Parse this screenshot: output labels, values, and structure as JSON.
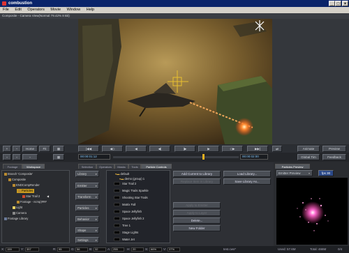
{
  "window": {
    "title": "combustion",
    "minimize": "_",
    "maximize": "□",
    "close": "×"
  },
  "menu": [
    "File",
    "Edit",
    "Operators",
    "Movie",
    "Window",
    "Help"
  ],
  "viewport": {
    "title": "Composite - Camera View(Normal 79.42% 8 Bit)"
  },
  "toolbar": {
    "home": "Home",
    "fit": "Fit",
    "animate": "Animate",
    "preview": "Preview",
    "feedback": "Feedback",
    "global_time": "Global Tim"
  },
  "timebar": {
    "current": "00:00:01:12",
    "end": "00:00:02:00"
  },
  "tabs_left": [
    "Footage",
    "Workspace"
  ],
  "tabs_mid": [
    "Selection",
    "Operators",
    "Masks",
    "Tools",
    "Particle Controls"
  ],
  "preview_tab": "Particles Preview",
  "preview_mode": "Emitter Preview",
  "preview_fps": "fps 30",
  "tree": [
    {
      "label": "Branch 'Composite'",
      "depth": 0
    },
    {
      "label": "Composite",
      "depth": 1
    },
    {
      "label": "ENDCompRender",
      "depth": 2
    },
    {
      "label": "Particles",
      "depth": 3,
      "selected": true
    },
    {
      "label": "Star Trail 2",
      "depth": 4
    },
    {
      "label": "Footage - ncmp)###",
      "depth": 3
    },
    {
      "label": "Light",
      "depth": 2
    },
    {
      "label": "Camera",
      "depth": 2
    },
    {
      "label": "Footage Library",
      "depth": 0
    }
  ],
  "categories": [
    "Library",
    "Emitter",
    "Transform",
    "Particles",
    "Behavior",
    "Shape",
    "Settings"
  ],
  "library": {
    "root": "default",
    "group": "demo (group) 1",
    "items": [
      "Star Trail 2",
      "Magic Trails Sparkle",
      "Shooting Star Trails",
      "Matrix Fall",
      "Space Jellyfish",
      "Space Jellyfish 2",
      "Tree 1",
      "Stage Lights",
      "Water Jet"
    ]
  },
  "library_buttons": [
    {
      "label": "Add Current to Library",
      "enabled": true
    },
    {
      "label": "Load Library...",
      "enabled": true
    },
    {
      "label": "Replace Item in Library",
      "enabled": false
    },
    {
      "label": "Save Library As...",
      "enabled": true
    },
    {
      "label": "Apply to Emitter",
      "enabled": false
    },
    {
      "label": "Apply to Layer",
      "enabled": false
    },
    {
      "label": "Delete...",
      "enabled": true
    },
    {
      "label": "New Folder",
      "enabled": true
    }
  ],
  "status": {
    "x_label": "X:",
    "x": "159",
    "y_label": "Y:",
    "y": "357",
    "r_label": "R:",
    "r": "95",
    "g_label": "G:",
    "g": "56",
    "b_label": "B:",
    "b": "32",
    "a_label": "A:",
    "a": "255",
    "h_label": "H:",
    "h": "20",
    "s_label": "S:",
    "s": "66%",
    "v_label": "V:",
    "v": "37%",
    "file": "test.cws*",
    "used": "Used: 57.6M",
    "total": "Total: 466M",
    "page": "0/4"
  },
  "colors": {
    "accent": "#c89b20",
    "title_bg": "#0a246a",
    "panel": "#2e3035"
  }
}
